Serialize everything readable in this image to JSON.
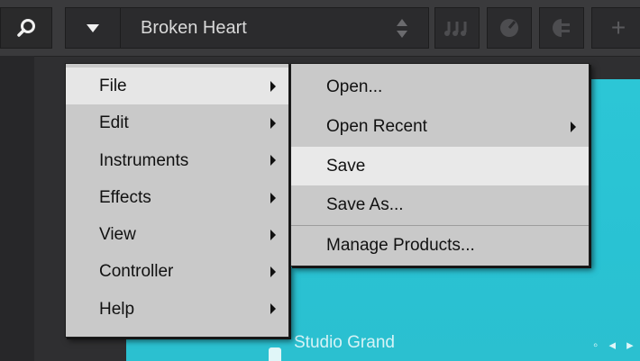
{
  "header": {
    "preset_title": "Broken Heart",
    "add_symbol": "+"
  },
  "main_menu": {
    "items": [
      {
        "label": "File",
        "has_submenu": true,
        "active": true
      },
      {
        "label": "Edit",
        "has_submenu": true
      },
      {
        "label": "Instruments",
        "has_submenu": true
      },
      {
        "label": "Effects",
        "has_submenu": true
      },
      {
        "label": "View",
        "has_submenu": true
      },
      {
        "label": "Controller",
        "has_submenu": true
      },
      {
        "label": "Help",
        "has_submenu": true
      }
    ]
  },
  "file_submenu": {
    "items": [
      {
        "label": "Open..."
      },
      {
        "label": "Open Recent",
        "has_submenu": true
      },
      {
        "label": "Save",
        "highlighted": true
      },
      {
        "label": "Save As..."
      },
      {
        "label": "Manage Products..."
      }
    ]
  },
  "background": {
    "instrument_label": "Studio Grand"
  },
  "colors": {
    "toolbar": "#3a3a3c",
    "menu": "#c9c9c9",
    "menu_highlight": "#e9e9e9",
    "accent_panel": "#2cc6d6"
  }
}
